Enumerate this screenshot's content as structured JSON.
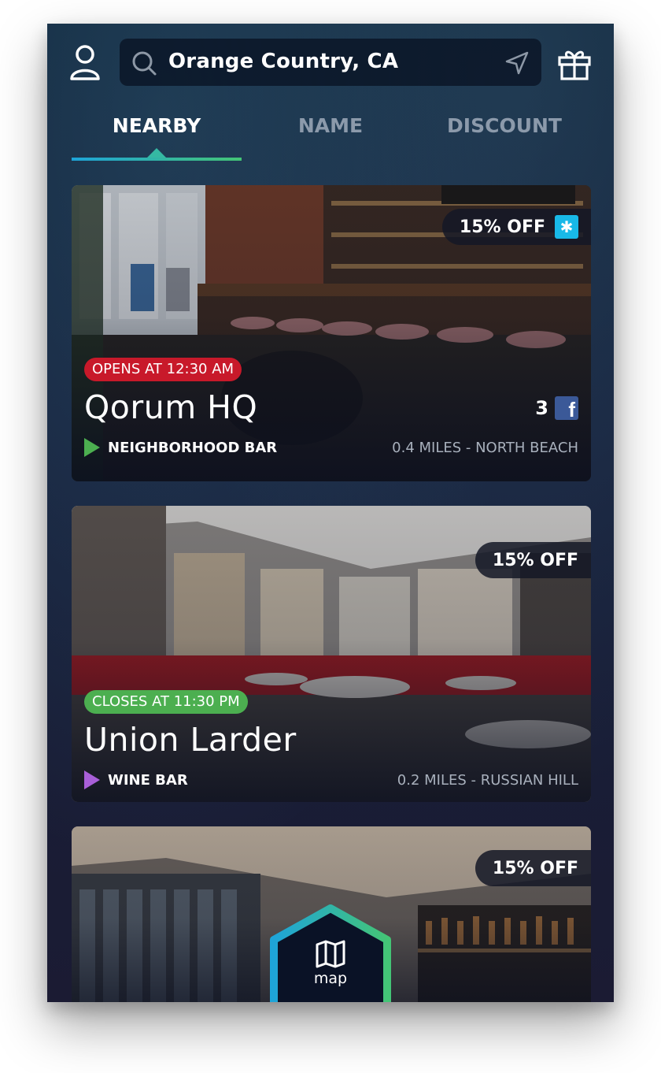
{
  "header": {
    "search_value": "Orange Country, CA"
  },
  "tabs": [
    {
      "label": "NEARBY",
      "active": true
    },
    {
      "label": "NAME",
      "active": false
    },
    {
      "label": "DISCOUNT",
      "active": false
    }
  ],
  "venues": [
    {
      "discount": "15% OFF",
      "discount_icon": "snowflake-icon",
      "status": "OPENS AT 12:30 AM",
      "status_color": "#c8192a",
      "name": "Qorum HQ",
      "facebook_count": "3",
      "type": "NEIGHBORHOOD BAR",
      "type_color": "#4caf50",
      "distance": "0.4 MILES - NORTH BEACH"
    },
    {
      "discount": "15% OFF",
      "status": "CLOSES AT 11:30 PM",
      "status_color": "#4caf50",
      "name": "Union Larder",
      "type": "WINE BAR",
      "type_color": "#a85fd8",
      "distance": "0.2 MILES - RUSSIAN HILL"
    },
    {
      "discount": "15% OFF"
    }
  ],
  "map_button": {
    "label": "map"
  },
  "colors": {
    "accent_blue": "#1ea4d8",
    "accent_green": "#44c576",
    "facebook": "#3b5998",
    "snow_badge": "#18b9e8"
  }
}
